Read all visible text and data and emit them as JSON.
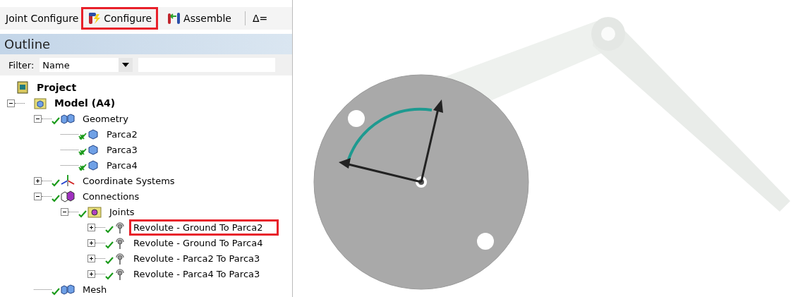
{
  "toolbar": {
    "label": "Joint Configure",
    "buttons": [
      {
        "label": "Configure",
        "kind": "configure",
        "highlighted": true
      },
      {
        "label": "Assemble",
        "kind": "assemble",
        "highlighted": false
      }
    ],
    "delta": "Δ="
  },
  "outline": {
    "title": "Outline",
    "filter": {
      "label": "Filter:",
      "value": "Name"
    },
    "tree": [
      {
        "label": "Project",
        "kind": "project",
        "highlighted": false
      },
      {
        "label": "Model (A4)",
        "kind": "model",
        "expanded": true,
        "highlighted": false,
        "children": [
          {
            "label": "Geometry",
            "kind": "geometry",
            "expanded": true,
            "highlighted": false,
            "children": [
              {
                "label": "Parca2",
                "kind": "part",
                "highlighted": false
              },
              {
                "label": "Parca3",
                "kind": "part",
                "highlighted": false
              },
              {
                "label": "Parca4",
                "kind": "part",
                "highlighted": false
              }
            ]
          },
          {
            "label": "Coordinate Systems",
            "kind": "coords",
            "expanded": false,
            "highlighted": false
          },
          {
            "label": "Connections",
            "kind": "connections",
            "expanded": true,
            "highlighted": false,
            "children": [
              {
                "label": "Joints",
                "kind": "joints",
                "expanded": true,
                "highlighted": false,
                "children": [
                  {
                    "label": "Revolute - Ground To Parca2",
                    "kind": "joint",
                    "expanded": false,
                    "highlighted": true
                  },
                  {
                    "label": "Revolute - Ground To Parca4",
                    "kind": "joint",
                    "expanded": false,
                    "highlighted": false
                  },
                  {
                    "label": "Revolute - Parca2 To Parca3",
                    "kind": "joint",
                    "expanded": false,
                    "highlighted": false
                  },
                  {
                    "label": "Revolute - Parca4 To Parca3",
                    "kind": "joint",
                    "expanded": false,
                    "highlighted": false
                  }
                ]
              }
            ]
          },
          {
            "label": "Mesh",
            "kind": "mesh",
            "highlighted": false
          }
        ]
      }
    ]
  }
}
